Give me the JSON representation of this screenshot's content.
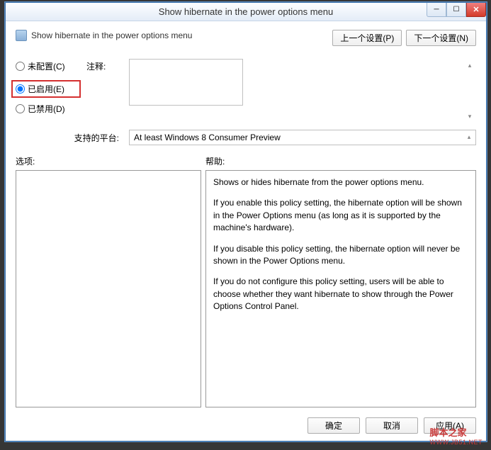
{
  "titlebar": {
    "title": "Show hibernate in the power options menu"
  },
  "header": {
    "title": "Show hibernate in the power options menu",
    "prev_button": "上一个设置(P)",
    "next_button": "下一个设置(N)"
  },
  "radios": {
    "not_configured": "未配置(C)",
    "enabled": "已启用(E)",
    "disabled": "已禁用(D)",
    "selected": "enabled"
  },
  "comment": {
    "label": "注释:",
    "value": ""
  },
  "platform": {
    "label": "支持的平台:",
    "value": "At least Windows 8 Consumer Preview"
  },
  "labels": {
    "options": "选项:",
    "help": "帮助:"
  },
  "help": {
    "p1": "Shows or hides hibernate from the power options menu.",
    "p2": "If you enable this policy setting, the hibernate option will be shown in the Power Options menu (as long as it is supported by the machine's hardware).",
    "p3": "If you disable this policy setting, the hibernate option will never be shown in the Power Options menu.",
    "p4": "If you do not configure this policy setting, users will be able to choose whether they want hibernate to show through the Power Options Control Panel."
  },
  "footer": {
    "ok": "确定",
    "cancel": "取消",
    "apply": "应用(A)"
  },
  "watermark": {
    "main": "脚本之家",
    "sub": "WWW.JB51.NET"
  }
}
